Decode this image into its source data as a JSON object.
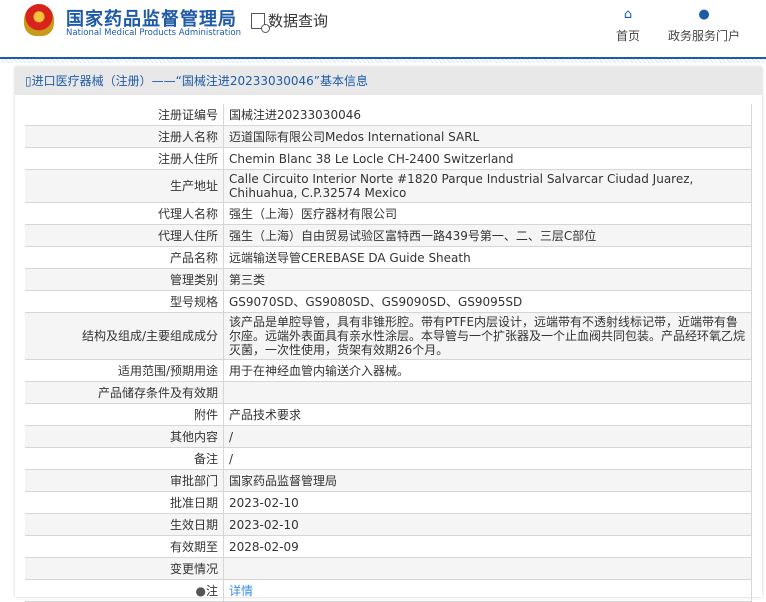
{
  "header": {
    "logo_cn": "国家药品监督管理局",
    "logo_en": "National Medical Products Administration",
    "data_query": "数据查询",
    "nav": [
      {
        "label": "首页",
        "icon": "home-icon"
      },
      {
        "label": "政务服务门户",
        "icon": "user-icon"
      }
    ]
  },
  "panel": {
    "title": "进口医疗器械（注册）——“国械注进20233030046”基本信息"
  },
  "rows": [
    {
      "label": "注册证编号",
      "value": "国械注进20233030046"
    },
    {
      "label": "注册人名称",
      "value": "迈道国际有限公司Medos International SARL"
    },
    {
      "label": "注册人住所",
      "value": "Chemin Blanc 38 Le Locle CH-2400 Switzerland"
    },
    {
      "label": "生产地址",
      "value": "Calle Circuito Interior Norte #1820 Parque Industrial Salvarcar Ciudad Juarez, Chihuahua, C.P.32574 Mexico"
    },
    {
      "label": "代理人名称",
      "value": "强生（上海）医疗器材有限公司"
    },
    {
      "label": "代理人住所",
      "value": "强生（上海）自由贸易试验区富特西一路439号第一、二、三层C部位"
    },
    {
      "label": "产品名称",
      "value": "远端输送导管CEREBASE DA Guide Sheath"
    },
    {
      "label": "管理类别",
      "value": "第三类"
    },
    {
      "label": "型号规格",
      "value": "GS9070SD、GS9080SD、GS9090SD、GS9095SD"
    },
    {
      "label": "结构及组成/主要组成成分",
      "value": "该产品是单腔导管，具有非锥形腔。带有PTFE内层设计，远端带有不透射线标记带，近端带有鲁尔座。远端外表面具有亲水性涂层。本导管与一个扩张器及一个止血阀共同包装。产品经环氧乙烷灭菌，一次性使用，货架有效期26个月。"
    },
    {
      "label": "适用范围/预期用途",
      "value": "用于在神经血管内输送介入器械。"
    },
    {
      "label": "产品储存条件及有效期",
      "value": ""
    },
    {
      "label": "附件",
      "value": "产品技术要求"
    },
    {
      "label": "其他内容",
      "value": "/"
    },
    {
      "label": "备注",
      "value": "/"
    },
    {
      "label": "审批部门",
      "value": "国家药品监督管理局"
    },
    {
      "label": "批准日期",
      "value": "2023-02-10"
    },
    {
      "label": "生效日期",
      "value": "2023-02-10"
    },
    {
      "label": "有效期至",
      "value": "2028-02-09"
    },
    {
      "label": "变更情况",
      "value": ""
    }
  ],
  "note": {
    "label": "注",
    "link": "详情"
  }
}
